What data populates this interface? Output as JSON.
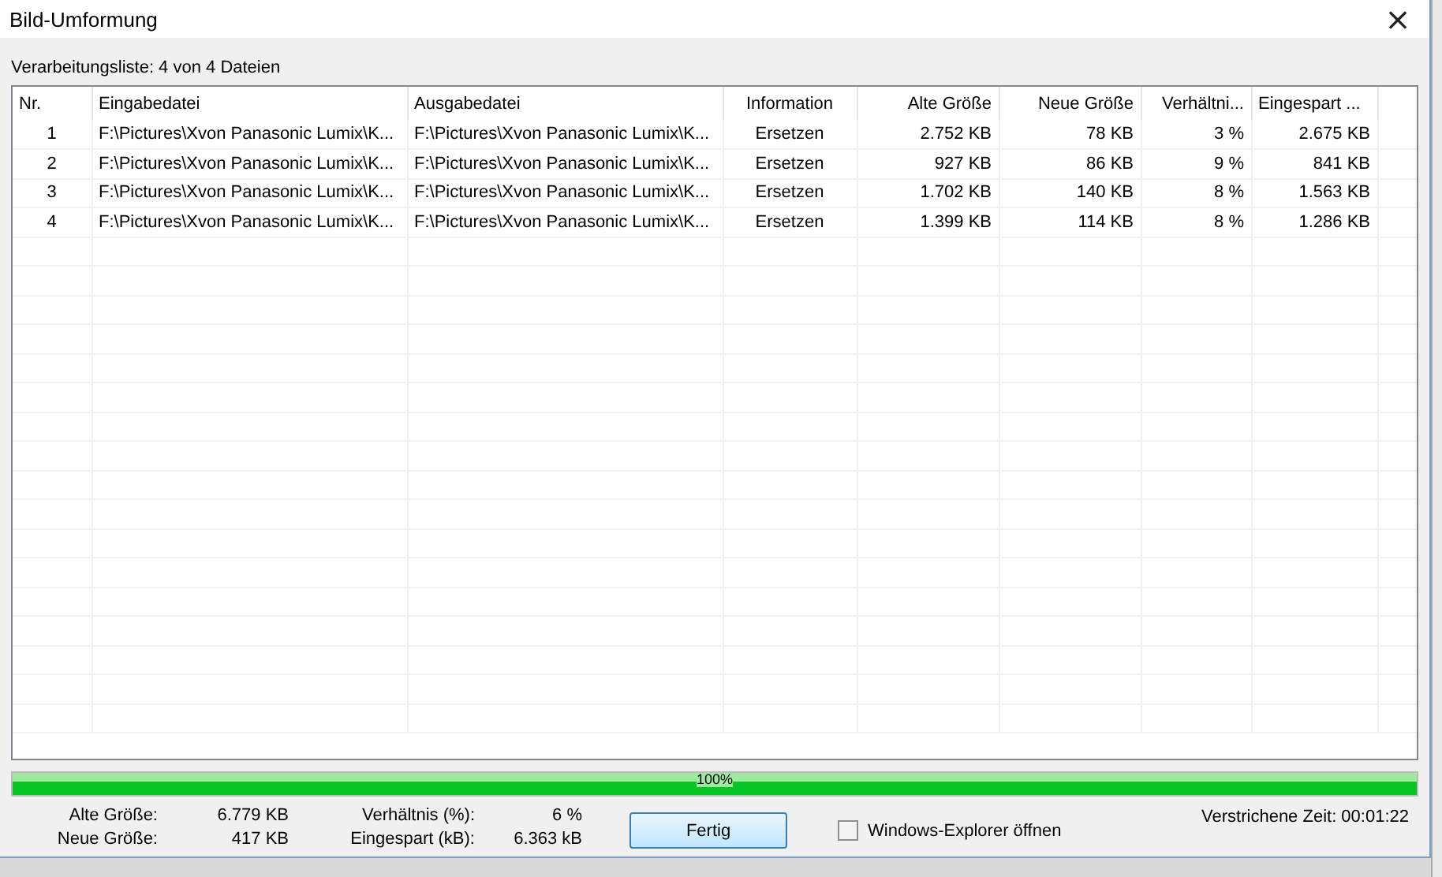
{
  "window": {
    "title": "Bild-Umformung",
    "close": "×"
  },
  "list_caption": "Verarbeitungsliste: 4 von 4 Dateien",
  "table": {
    "columns": [
      {
        "label": "Nr."
      },
      {
        "label": "Eingabedatei"
      },
      {
        "label": "Ausgabedatei"
      },
      {
        "label": "Information"
      },
      {
        "label": "Alte Größe"
      },
      {
        "label": "Neue Größe"
      },
      {
        "label": "Verhältni..."
      },
      {
        "label": "Eingespart ..."
      }
    ],
    "rows": [
      [
        "1",
        "F:\\Pictures\\Xvon Panasonic Lumix\\K...",
        "F:\\Pictures\\Xvon Panasonic Lumix\\K...",
        "Ersetzen",
        "2.752 KB",
        "78 KB",
        "3 %",
        "2.675 KB"
      ],
      [
        "2",
        "F:\\Pictures\\Xvon Panasonic Lumix\\K...",
        "F:\\Pictures\\Xvon Panasonic Lumix\\K...",
        "Ersetzen",
        "927 KB",
        "86 KB",
        "9 %",
        "841 KB"
      ],
      [
        "3",
        "F:\\Pictures\\Xvon Panasonic Lumix\\K...",
        "F:\\Pictures\\Xvon Panasonic Lumix\\K...",
        "Ersetzen",
        "1.702 KB",
        "140 KB",
        "8 %",
        "1.563 KB"
      ],
      [
        "4",
        "F:\\Pictures\\Xvon Panasonic Lumix\\K...",
        "F:\\Pictures\\Xvon Panasonic Lumix\\K...",
        "Ersetzen",
        "1.399 KB",
        "114 KB",
        "8 %",
        "1.286 KB"
      ]
    ]
  },
  "progress": {
    "level": 1,
    "label": "100%"
  },
  "stats": [
    {
      "label": "Alte Größe:",
      "value": "6.779 KB"
    },
    {
      "label": "Verhältnis (%):",
      "value": "6 %"
    },
    {
      "label": "Neue Größe:",
      "value": "417 KB"
    },
    {
      "label": "Eingespart (kB):",
      "value": "6.363 kB"
    }
  ],
  "button": "Fertig",
  "checkbox": {
    "label": "Windows-Explorer öffnen",
    "checked": false
  },
  "elapsed": "Verstrichene Zeit: 00:01:22"
}
